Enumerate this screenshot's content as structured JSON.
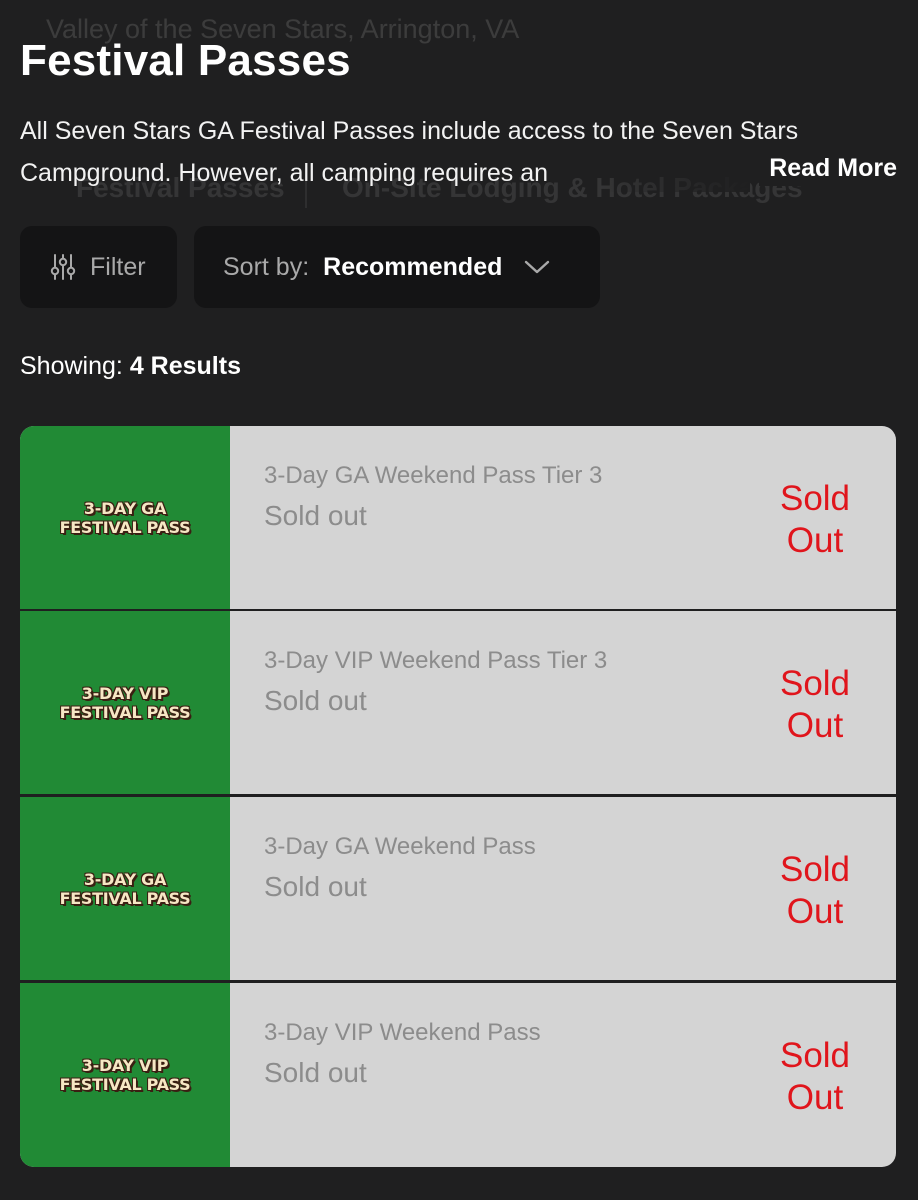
{
  "background": {
    "location": "Valley of the Seven Stars, Arrington, VA",
    "tabs": [
      "Festival Passes",
      "On-Site Lodging & Hotel Packages"
    ]
  },
  "header": {
    "title": "Festival Passes",
    "description": "All Seven Stars GA Festival Passes include access to the Seven Stars Campground. However, all camping requires an",
    "read_more": "Read More"
  },
  "controls": {
    "filter_label": "Filter",
    "filter_icon": "sliders-icon",
    "sort_label": "Sort by:",
    "sort_value": "Recommended",
    "sort_icon": "chevron-down-icon"
  },
  "results": {
    "prefix": "Showing:",
    "count_text": "4 Results"
  },
  "colors": {
    "page_background": "#1f1f20",
    "thumb_green": "#218a35",
    "row_background": "#d4d4d4",
    "sold_out_red": "#e0151c"
  },
  "passes": [
    {
      "thumb_line1": "3-DAY GA",
      "thumb_line2": "FESTIVAL PASS",
      "name": "3-Day GA Weekend Pass Tier 3",
      "status": "Sold out",
      "sold_line1": "Sold",
      "sold_line2": "Out"
    },
    {
      "thumb_line1": "3-DAY VIP",
      "thumb_line2": "FESTIVAL PASS",
      "name": "3-Day VIP Weekend Pass Tier 3",
      "status": "Sold out",
      "sold_line1": "Sold",
      "sold_line2": "Out"
    },
    {
      "thumb_line1": "3-DAY GA",
      "thumb_line2": "FESTIVAL PASS",
      "name": "3-Day GA Weekend Pass",
      "status": "Sold out",
      "sold_line1": "Sold",
      "sold_line2": "Out"
    },
    {
      "thumb_line1": "3-DAY VIP",
      "thumb_line2": "FESTIVAL PASS",
      "name": "3-Day VIP Weekend Pass",
      "status": "Sold out",
      "sold_line1": "Sold",
      "sold_line2": "Out"
    }
  ]
}
